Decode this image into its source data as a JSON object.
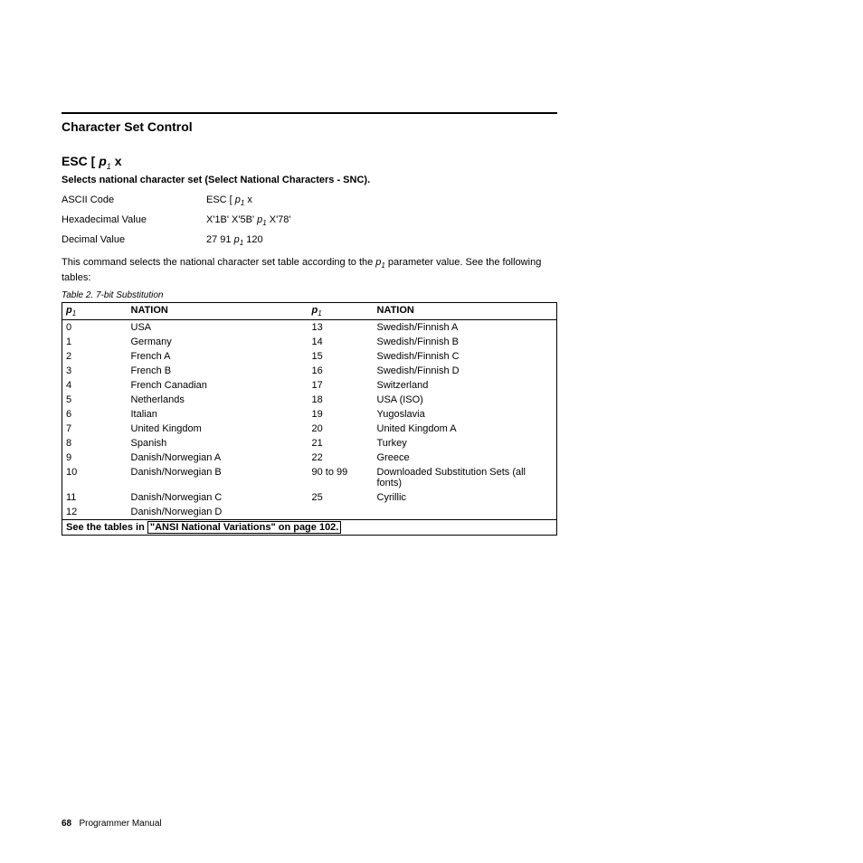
{
  "section": {
    "title": "Character Set Control"
  },
  "command": {
    "prefix": "ESC [ ",
    "param": "p",
    "paramSub": "1",
    "suffix": " x",
    "desc": "Selects national character set (Select National Characters - SNC)."
  },
  "codes": {
    "ascii": {
      "label": "ASCII Code",
      "value_pre": "ESC [ ",
      "p": "p",
      "sub": "1",
      "value_post": " x"
    },
    "hex": {
      "label": "Hexadecimal Value",
      "value_pre": "X'1B' X'5B' ",
      "p": "p",
      "sub": "1",
      "value_post": " X'78'"
    },
    "dec": {
      "label": "Decimal Value",
      "value_pre": "27 91 ",
      "p": "p",
      "sub": "1",
      "value_post": " 120"
    }
  },
  "body": {
    "pre": "This command selects the national character set table according to the ",
    "p": "p",
    "sub": "1",
    "post": " parameter value. See the following tables:"
  },
  "table": {
    "caption": "Table 2. 7-bit Substitution",
    "head": {
      "p": "p",
      "sub": "1",
      "nation": "NATION"
    },
    "rows": [
      {
        "p1": "0",
        "n1": "USA",
        "p2": "13",
        "n2": "Swedish/Finnish A"
      },
      {
        "p1": "1",
        "n1": "Germany",
        "p2": "14",
        "n2": "Swedish/Finnish B"
      },
      {
        "p1": "2",
        "n1": "French A",
        "p2": "15",
        "n2": "Swedish/Finnish C"
      },
      {
        "p1": "3",
        "n1": "French B",
        "p2": "16",
        "n2": "Swedish/Finnish D"
      },
      {
        "p1": "4",
        "n1": "French Canadian",
        "p2": "17",
        "n2": "Switzerland"
      },
      {
        "p1": "5",
        "n1": "Netherlands",
        "p2": "18",
        "n2": "USA (ISO)"
      },
      {
        "p1": "6",
        "n1": "Italian",
        "p2": "19",
        "n2": "Yugoslavia"
      },
      {
        "p1": "7",
        "n1": "United Kingdom",
        "p2": "20",
        "n2": "United Kingdom A"
      },
      {
        "p1": "8",
        "n1": "Spanish",
        "p2": "21",
        "n2": "Turkey"
      },
      {
        "p1": "9",
        "n1": "Danish/Norwegian A",
        "p2": "22",
        "n2": "Greece"
      },
      {
        "p1": "10",
        "n1": "Danish/Norwegian B",
        "p2": "90 to 99",
        "n2": "Downloaded Substitution Sets (all fonts)"
      },
      {
        "p1": "11",
        "n1": "Danish/Norwegian C",
        "p2": "25",
        "n2": "Cyrillic"
      },
      {
        "p1": "12",
        "n1": "Danish/Norwegian D",
        "p2": "",
        "n2": ""
      }
    ],
    "footer": {
      "pre": "See the tables in ",
      "link": "\"ANSI National Variations\" on page 102."
    }
  },
  "footer": {
    "pageNum": "68",
    "doc": "Programmer Manual"
  }
}
